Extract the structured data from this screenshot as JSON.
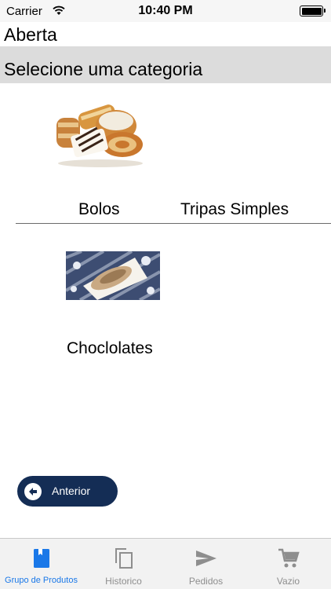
{
  "status_bar": {
    "carrier": "Carrier",
    "time": "10:40 PM",
    "icons": [
      "wifi-icon",
      "battery-icon"
    ]
  },
  "header": {
    "title": "Aberta",
    "subtitle": "Selecione uma categoria"
  },
  "categories": [
    {
      "label": "Bolos",
      "image": "pastries-image"
    },
    {
      "label": "Tripas Simples",
      "image": ""
    },
    {
      "label": "Choclolates",
      "image": "chocolates-image"
    }
  ],
  "back_button": {
    "label": "Anterior",
    "icon": "arrow-left-icon"
  },
  "tab_bar": {
    "tabs": [
      {
        "label": "Grupo de Produtos",
        "icon": "bookmark-icon",
        "active": true
      },
      {
        "label": "Historico",
        "icon": "copy-icon",
        "active": false
      },
      {
        "label": "Pedidos",
        "icon": "send-icon",
        "active": false
      },
      {
        "label": "Vazio",
        "icon": "cart-icon",
        "active": false
      }
    ]
  },
  "colors": {
    "accent": "#1a78e8",
    "button_bg": "#142d55",
    "subtitle_bg": "#dcdcdc",
    "tab_inactive": "#8e8e8e"
  }
}
